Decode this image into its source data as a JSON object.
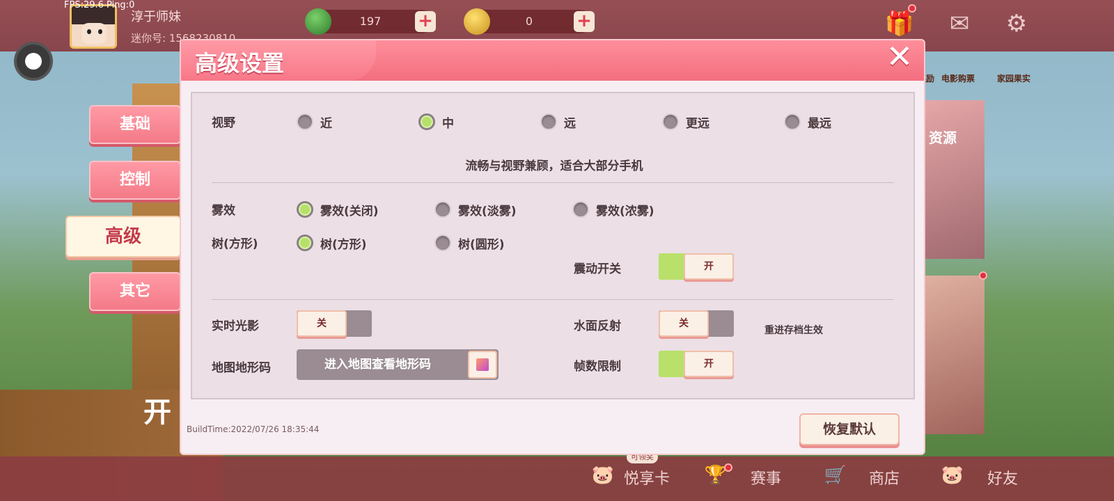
{
  "overlay": {
    "fps_text": "FPS:29.6  Ping:0"
  },
  "profile": {
    "username": "淳于师妹",
    "user_id": "迷你号: 1568230810"
  },
  "currencies": [
    {
      "name": "green-gem",
      "value": "197",
      "plus": "+"
    },
    {
      "name": "gold-coin",
      "value": "0",
      "plus": "+"
    }
  ],
  "top_icons": [
    "gift-icon",
    "mail-icon",
    "gear-icon"
  ],
  "right_menu": {
    "tag1": "奖励",
    "tag2": "电影购票",
    "tag3": "家园果实",
    "resource": "资源"
  },
  "bottom_nav": {
    "card_tag": "可领奖",
    "items": [
      "悦享卡",
      "赛事",
      "商店",
      "好友"
    ]
  },
  "background_text": {
    "start": "开"
  },
  "dialog": {
    "title": "高级设置",
    "close": "✕",
    "tabs": [
      "基础",
      "控制",
      "高级",
      "其它"
    ],
    "active_tab": "高级",
    "view": {
      "label": "视野",
      "options": [
        "近",
        "中",
        "远",
        "更远",
        "最远"
      ],
      "selected": "中",
      "description": "流畅与视野兼顾，适合大部分手机"
    },
    "fog": {
      "label": "雾效",
      "options": [
        "雾效(关闭)",
        "雾效(淡雾)",
        "雾效(浓雾)"
      ],
      "selected": "雾效(关闭)"
    },
    "tree": {
      "label": "树(方形)",
      "options": [
        "树(方形)",
        "树(圆形)"
      ],
      "selected": "树(方形)"
    },
    "vibration": {
      "label": "震动开关",
      "state": "开"
    },
    "realtime_shadow": {
      "label": "实时光影",
      "state": "关"
    },
    "water_reflection": {
      "label": "水面反射",
      "state": "关",
      "note": "重进存档生效"
    },
    "terrain_code": {
      "label": "地图地形码",
      "button": "进入地图查看地形码"
    },
    "frame_limit": {
      "label": "帧数限制",
      "state": "开"
    },
    "build_time": "BuildTime:2022/07/26 18:35:44",
    "reset_button": "恢复默认"
  },
  "colors": {
    "accent_pink": "#f36f7f",
    "toggle_on": "#b8e06a",
    "toggle_off": "#9a8c92",
    "panel_bg": "#ecdfe6"
  }
}
